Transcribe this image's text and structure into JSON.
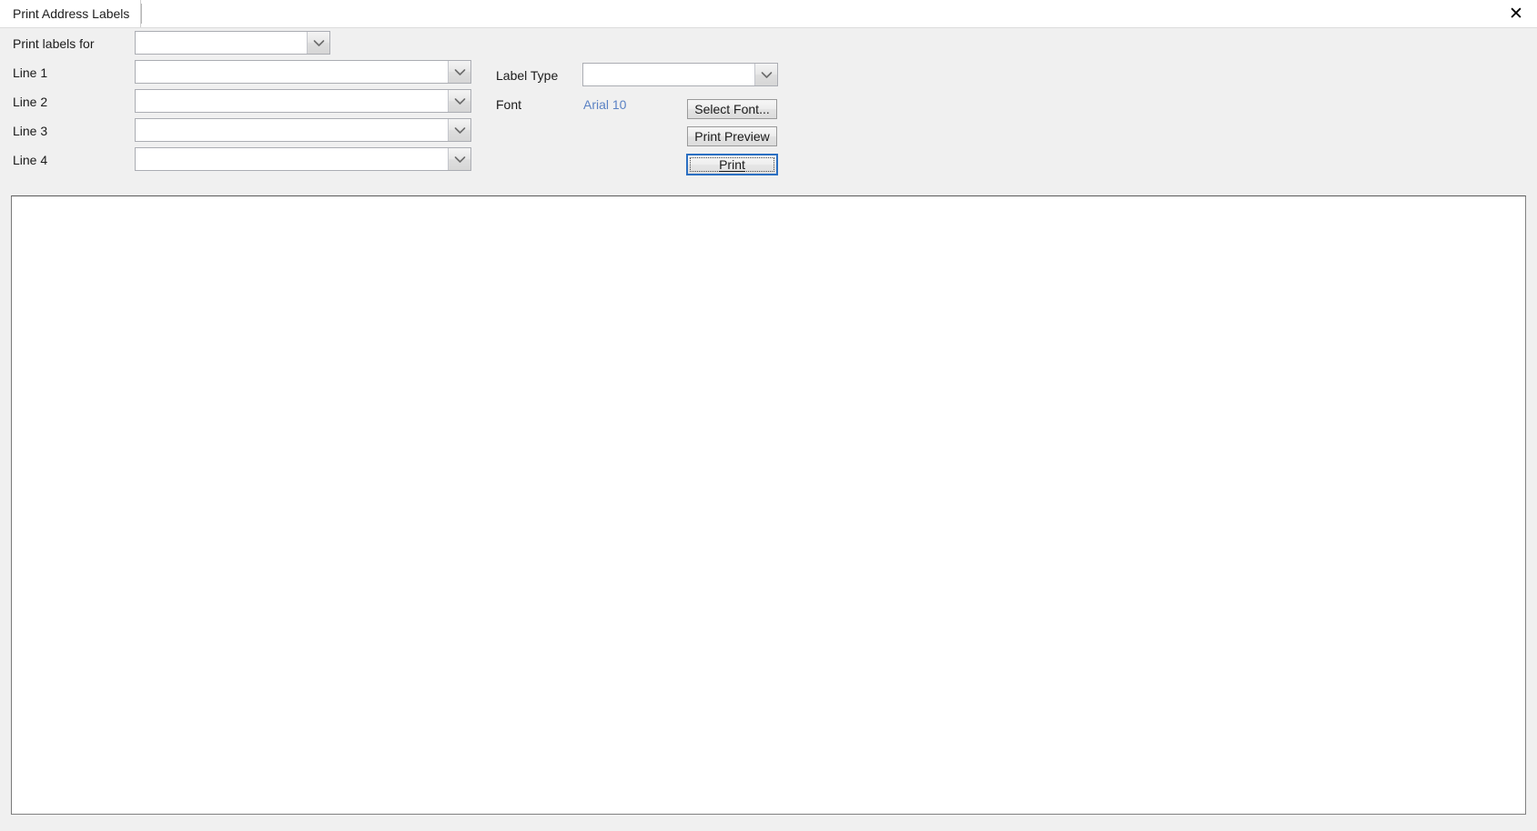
{
  "window": {
    "close_label": "✕"
  },
  "tabs": [
    {
      "label": "Print Address Labels",
      "active": true
    }
  ],
  "form": {
    "print_labels_for": {
      "label": "Print labels for",
      "value": "",
      "placeholder": ""
    },
    "lines": [
      {
        "label": "Line 1",
        "value": "",
        "placeholder": ""
      },
      {
        "label": "Line 2",
        "value": "",
        "placeholder": ""
      },
      {
        "label": "Line 3",
        "value": "",
        "placeholder": ""
      },
      {
        "label": "Line 4",
        "value": "",
        "placeholder": ""
      }
    ],
    "label_type": {
      "label": "Label Type",
      "value": "",
      "placeholder": ""
    },
    "font": {
      "label": "Font",
      "value": "Arial 10",
      "value_color": "#5b82c4"
    }
  },
  "buttons": {
    "select_font": "Select Font...",
    "print_preview": "Print Preview",
    "print": "Print"
  },
  "content": {
    "preview_text": ""
  },
  "colors": {
    "panel_background": "#f0f0f0",
    "content_background": "#ffffff",
    "focus_border": "#2b6fc2",
    "link_text": "#5b82c4",
    "field_border": "#abadb3"
  }
}
